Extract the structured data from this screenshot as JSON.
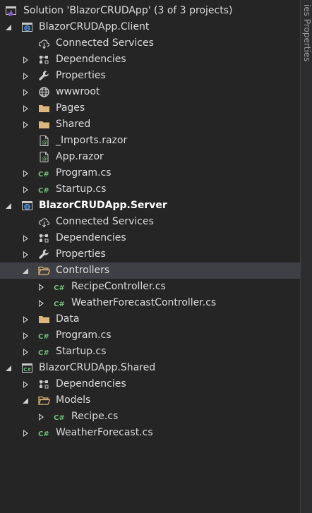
{
  "solution": {
    "label": "Solution 'BlazorCRUDApp' (3 of 3 projects)"
  },
  "side_tab": {
    "text": "ies   Properties"
  },
  "rows": [
    {
      "label": "BlazorCRUDApp.Client",
      "icon": "web-project-icon",
      "expander": "expanded"
    },
    {
      "label": "Connected Services",
      "icon": "connected-services-icon",
      "expander": "none"
    },
    {
      "label": "Dependencies",
      "icon": "dependencies-icon",
      "expander": "collapsed"
    },
    {
      "label": "Properties",
      "icon": "wrench-icon",
      "expander": "collapsed"
    },
    {
      "label": "wwwroot",
      "icon": "globe-icon",
      "expander": "collapsed"
    },
    {
      "label": "Pages",
      "icon": "folder-icon",
      "expander": "collapsed"
    },
    {
      "label": "Shared",
      "icon": "folder-icon",
      "expander": "collapsed"
    },
    {
      "label": "_Imports.razor",
      "icon": "razor-file-icon",
      "expander": "none"
    },
    {
      "label": "App.razor",
      "icon": "razor-file-icon",
      "expander": "none"
    },
    {
      "label": "Program.cs",
      "icon": "csharp-file-icon",
      "expander": "collapsed"
    },
    {
      "label": "Startup.cs",
      "icon": "csharp-file-icon",
      "expander": "collapsed"
    },
    {
      "label": "BlazorCRUDApp.Server",
      "icon": "web-project-icon",
      "expander": "expanded",
      "bold": true
    },
    {
      "label": "Connected Services",
      "icon": "connected-services-icon",
      "expander": "none"
    },
    {
      "label": "Dependencies",
      "icon": "dependencies-icon",
      "expander": "collapsed"
    },
    {
      "label": "Properties",
      "icon": "wrench-icon",
      "expander": "collapsed"
    },
    {
      "label": "Controllers",
      "icon": "open-folder-icon",
      "expander": "expanded",
      "selected": true
    },
    {
      "label": "RecipeController.cs",
      "icon": "csharp-file-icon",
      "expander": "collapsed"
    },
    {
      "label": "WeatherForecastController.cs",
      "icon": "csharp-file-icon",
      "expander": "collapsed"
    },
    {
      "label": "Data",
      "icon": "folder-icon",
      "expander": "collapsed"
    },
    {
      "label": "Program.cs",
      "icon": "csharp-file-icon",
      "expander": "collapsed"
    },
    {
      "label": "Startup.cs",
      "icon": "csharp-file-icon",
      "expander": "collapsed"
    },
    {
      "label": "BlazorCRUDApp.Shared",
      "icon": "csharp-project-icon",
      "expander": "expanded"
    },
    {
      "label": "Dependencies",
      "icon": "dependencies-icon",
      "expander": "collapsed"
    },
    {
      "label": "Models",
      "icon": "open-folder-icon",
      "expander": "expanded"
    },
    {
      "label": "Recipe.cs",
      "icon": "csharp-file-icon",
      "expander": "collapsed"
    },
    {
      "label": "WeatherForecast.cs",
      "icon": "csharp-file-icon",
      "expander": "collapsed"
    }
  ],
  "colors": {
    "background": "#252526",
    "text": "#dcdcdc",
    "selection": "#3f3f46",
    "folder": "#dcb67a",
    "csharp": "#6fbf73",
    "project_blue": "#4f8fd6",
    "vs_purple": "#8661c5"
  }
}
